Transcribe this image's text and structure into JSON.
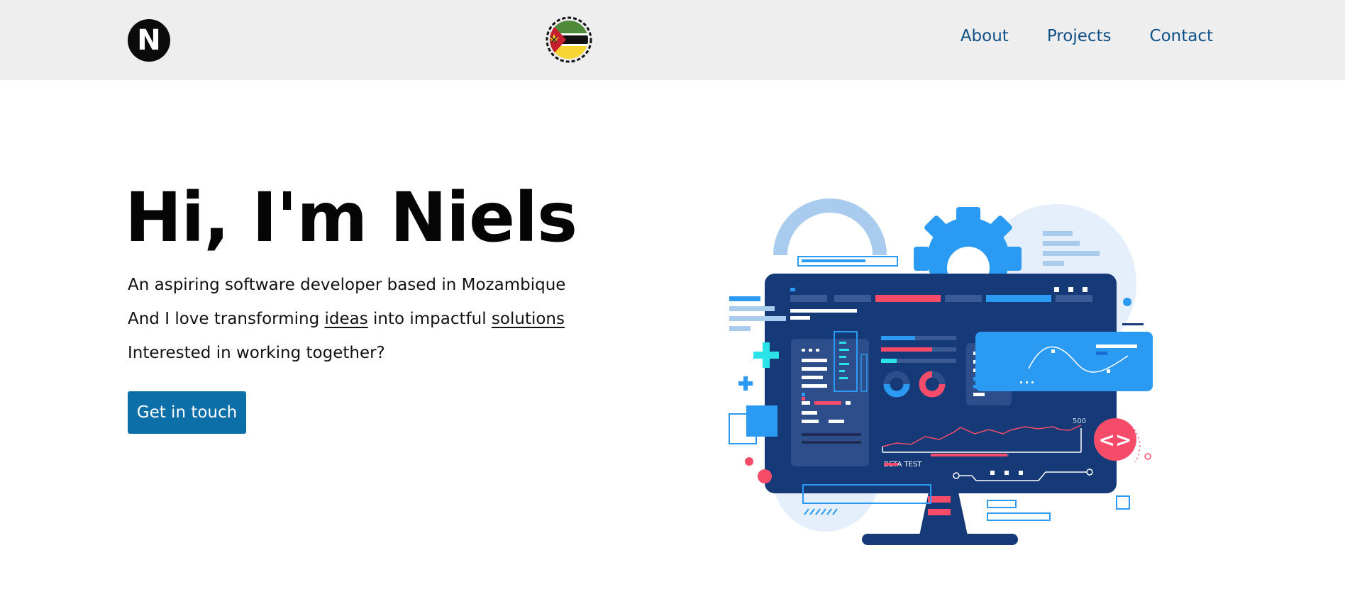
{
  "header": {
    "logo_letter": "N",
    "nav": [
      "About",
      "Projects",
      "Contact"
    ]
  },
  "hero": {
    "title": "Hi, I'm Niels",
    "line1": "An aspiring software developer based in Mozambique",
    "line2": {
      "before": "And I love transforming ",
      "link1": "ideas",
      "middle": " into impactful ",
      "link2": "solutions"
    },
    "line3": "Interested in working together?",
    "cta": "Get in touch"
  },
  "illustration": {
    "chart_label_max": "500",
    "chart_label_tag": "BETA TEST",
    "code_badge": "<>"
  },
  "colors": {
    "nav_link": "#0e4f86",
    "cta_bg": "#0d6fa8",
    "monitor_bg": "#163a77",
    "accent_blue": "#2b9af3",
    "accent_red": "#f64c6a"
  }
}
